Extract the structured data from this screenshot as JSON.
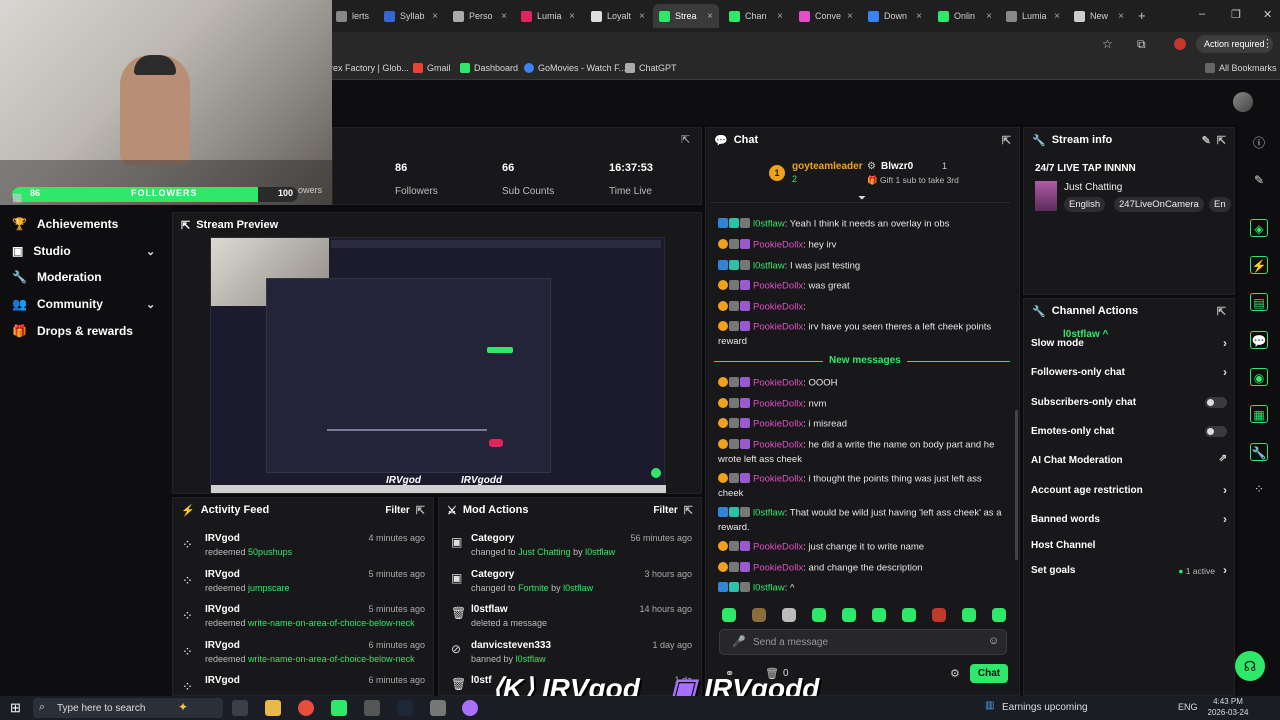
{
  "browser": {
    "tabs": [
      {
        "label": "lerts",
        "color": "#888"
      },
      {
        "label": "Syllab",
        "color": "#3367d6"
      },
      {
        "label": "Perso",
        "color": "#aaa"
      },
      {
        "label": "Lumia",
        "color": "#e0245e"
      },
      {
        "label": "Loyalt",
        "color": "#ddd"
      },
      {
        "label": "Strea",
        "color": "#2ee86a"
      },
      {
        "label": "Chan",
        "color": "#2ee86a"
      },
      {
        "label": "Conve",
        "color": "#e04fc7"
      },
      {
        "label": "Down",
        "color": "#3b82f6"
      },
      {
        "label": "Onlin",
        "color": "#2ee86a"
      },
      {
        "label": "Lumia",
        "color": "#888"
      },
      {
        "label": "New",
        "color": "#ccc"
      }
    ],
    "action_required": "Action required",
    "bookmarks": [
      "rex Factory | Glob...",
      "Gmail",
      "Dashboard",
      "GoMovies - Watch F...",
      "ChatGPT"
    ],
    "all_bookmarks": "All Bookmarks"
  },
  "webcam": {
    "followers_count": "86",
    "followers_label": "FOLLOWERS",
    "followers_goal": "100"
  },
  "stats": [
    {
      "value": "86",
      "label": "Followers"
    },
    {
      "value": "66",
      "label": "Sub Counts"
    },
    {
      "value": "16:37:53",
      "label": "Time Live"
    }
  ],
  "stats_partial_label": "owers",
  "sidebar": {
    "items": [
      {
        "label": "Achievements",
        "icon": "trophy-icon"
      },
      {
        "label": "Studio",
        "icon": "studio-icon",
        "chev": true
      },
      {
        "label": "Moderation",
        "icon": "wrench-icon"
      },
      {
        "label": "Community",
        "icon": "community-icon",
        "chev": true
      },
      {
        "label": "Drops & rewards",
        "icon": "gift-icon"
      }
    ]
  },
  "stream_preview": {
    "title": "Stream Preview",
    "overlay_1": "IRVgod",
    "overlay_2": "IRVgodd"
  },
  "activity_feed": {
    "title": "Activity Feed",
    "filter": "Filter",
    "items": [
      {
        "user": "IRVgod",
        "verb": "redeemed",
        "reward": "50pushups",
        "time": "4 minutes ago"
      },
      {
        "user": "IRVgod",
        "verb": "redeemed",
        "reward": "jumpscare",
        "time": "5 minutes ago"
      },
      {
        "user": "IRVgod",
        "verb": "redeemed",
        "reward": "write-name-on-area-of-choice-below-neck",
        "time": "5 minutes ago"
      },
      {
        "user": "IRVgod",
        "verb": "redeemed",
        "reward": "write-name-on-area-of-choice-below-neck",
        "time": "6 minutes ago"
      },
      {
        "user": "IRVgod",
        "verb": "",
        "reward": "",
        "time": "6 minutes ago"
      }
    ]
  },
  "mod_actions": {
    "title": "Mod Actions",
    "filter": "Filter",
    "items": [
      {
        "title": "Category",
        "line": "changed to",
        "target": "Just Chatting",
        "by": "by",
        "mod": "l0stflaw",
        "time": "56 minutes ago"
      },
      {
        "title": "Category",
        "line": "changed to",
        "target": "Fortnite",
        "by": "by",
        "mod": "l0stflaw",
        "time": "3 hours ago"
      },
      {
        "title": "l0stflaw",
        "line": "deleted a message",
        "target": "",
        "by": "",
        "mod": "",
        "time": "14 hours ago"
      },
      {
        "title": "danvicsteven333",
        "line": "banned by",
        "target": "",
        "by": "",
        "mod": "l0stflaw",
        "time": "1 day ago"
      },
      {
        "title": "l0stf",
        "line": "",
        "target": "",
        "by": "",
        "mod": "",
        "time": "1 da"
      }
    ]
  },
  "chat": {
    "title": "Chat",
    "leader": "goyteamleader",
    "leader_count": "2",
    "gifter": "Blwzr0",
    "gifter_count": "1",
    "gift_text": "Gift 1 sub to take 3rd",
    "new_messages": "New messages",
    "messages": [
      {
        "user": "l0stflaw",
        "color": "#2ee86a",
        "text": ": Yeah I think it needs an overlay in obs",
        "badges": "mod"
      },
      {
        "user": "PookieDollx",
        "color": "#e04fc7",
        "text": ": hey irv",
        "badges": "viewer"
      },
      {
        "user": "l0stflaw",
        "color": "#2ee86a",
        "text": ": I was just testing",
        "badges": "mod"
      },
      {
        "user": "PookieDollx",
        "color": "#e04fc7",
        "text": ": was great",
        "badges": "viewer"
      },
      {
        "user": "PookieDollx",
        "color": "#e04fc7",
        "text": ":",
        "badges": "viewer"
      },
      {
        "user": "PookieDollx",
        "color": "#e04fc7",
        "text": ": irv have you seen theres a left cheek points reward",
        "badges": "viewer"
      },
      {
        "user": "PookieDollx",
        "color": "#e04fc7",
        "text": ": OOOH",
        "badges": "viewer"
      },
      {
        "user": "PookieDollx",
        "color": "#e04fc7",
        "text": ": nvm",
        "badges": "viewer"
      },
      {
        "user": "PookieDollx",
        "color": "#e04fc7",
        "text": ": i misread",
        "badges": "viewer"
      },
      {
        "user": "PookieDollx",
        "color": "#e04fc7",
        "text": ": he did a write the name on body part and he wrote left ass cheek",
        "badges": "viewer"
      },
      {
        "user": "PookieDollx",
        "color": "#e04fc7",
        "text": ": i thought the points thing was just left ass cheek",
        "badges": "viewer"
      },
      {
        "user": "l0stflaw",
        "color": "#2ee86a",
        "text": ": That would be wild just having 'left ass cheek' as a reward.",
        "badges": "mod"
      },
      {
        "user": "PookieDollx",
        "color": "#e04fc7",
        "text": ": just change it to write name",
        "badges": "viewer"
      },
      {
        "user": "PookieDollx",
        "color": "#e04fc7",
        "text": ": and change the description",
        "badges": "viewer"
      },
      {
        "user": "l0stflaw",
        "color": "#2ee86a",
        "text": ": ^",
        "badges": "mod"
      }
    ],
    "placeholder": "Send a message",
    "points": "0",
    "chat_button": "Chat"
  },
  "stream_info": {
    "title": "Stream info",
    "stream_title": "24/7 LIVE TAP INNNN",
    "category": "Just Chatting",
    "tags": [
      "English",
      "247LiveOnCamera",
      "En"
    ]
  },
  "channel_actions": {
    "title": "Channel Actions",
    "tooltip": "l0stflaw ^",
    "rows": [
      {
        "label": "Slow mode",
        "kind": "chev"
      },
      {
        "label": "Followers-only chat",
        "kind": "chev"
      },
      {
        "label": "Subscribers-only chat",
        "kind": "toggle"
      },
      {
        "label": "Emotes-only chat",
        "kind": "toggle"
      },
      {
        "label": "AI Chat Moderation",
        "kind": "ext"
      },
      {
        "label": "Account age restriction",
        "kind": "chev"
      },
      {
        "label": "Banned words",
        "kind": "chev"
      },
      {
        "label": "Host Channel",
        "kind": "none"
      },
      {
        "label": "Set goals",
        "kind": "chev",
        "extra": "1 active"
      }
    ]
  },
  "taskbar": {
    "search": "Type here to search",
    "earnings": "Earnings upcoming",
    "lang": "ENG",
    "time": "4:43 PM",
    "date": "2026-03-24"
  },
  "colors": {
    "accent": "#2ee86a",
    "viewer": "#e04fc7",
    "panel": "#18181b"
  }
}
